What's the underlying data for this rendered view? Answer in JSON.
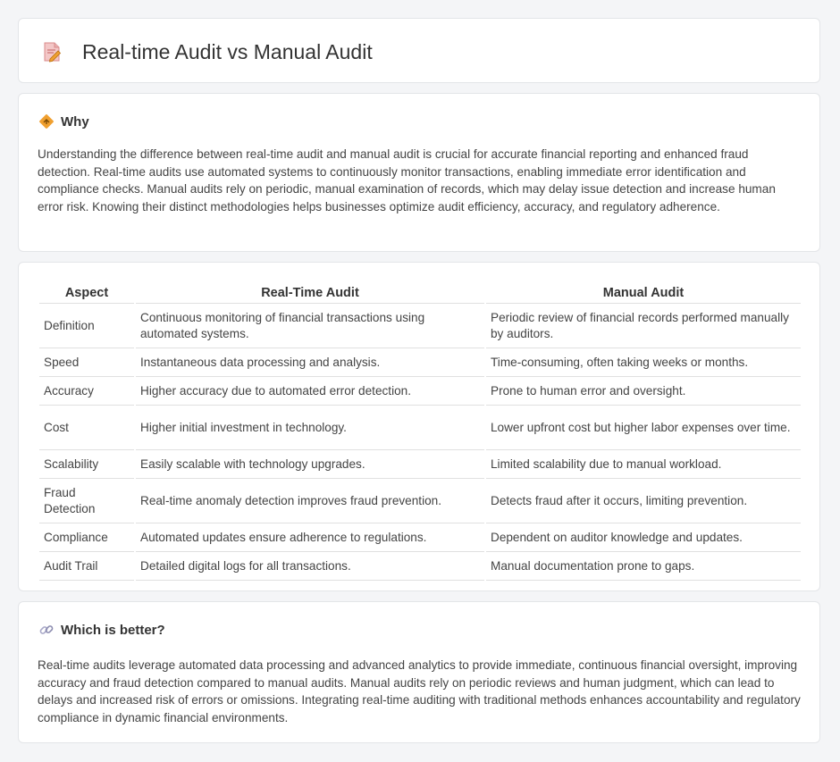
{
  "header": {
    "title": "Real-time Audit vs Manual Audit",
    "icon": "document-edit-icon"
  },
  "why": {
    "icon": "diamond-sign-icon",
    "title": "Why",
    "body": "Understanding the difference between real-time audit and manual audit is crucial for accurate financial reporting and enhanced fraud detection. Real-time audits use automated systems to continuously monitor transactions, enabling immediate error identification and compliance checks. Manual audits rely on periodic, manual examination of records, which may delay issue detection and increase human error risk. Knowing their distinct methodologies helps businesses optimize audit efficiency, accuracy, and regulatory adherence."
  },
  "table": {
    "headers": [
      "Aspect",
      "Real-Time Audit",
      "Manual Audit"
    ],
    "rows": [
      [
        "Definition",
        "Continuous monitoring of financial transactions using automated systems.",
        "Periodic review of financial records performed manually by auditors."
      ],
      [
        "Speed",
        "Instantaneous data processing and analysis.",
        "Time-consuming, often taking weeks or months."
      ],
      [
        "Accuracy",
        "Higher accuracy due to automated error detection.",
        "Prone to human error and oversight."
      ],
      [
        "Cost",
        "Higher initial investment in technology.",
        "Lower upfront cost but higher labor expenses over time."
      ],
      [
        "Scalability",
        "Easily scalable with technology upgrades.",
        "Limited scalability due to manual workload."
      ],
      [
        "Fraud Detection",
        "Real-time anomaly detection improves fraud prevention.",
        "Detects fraud after it occurs, limiting prevention."
      ],
      [
        "Compliance",
        "Automated updates ensure adherence to regulations.",
        "Dependent on auditor knowledge and updates."
      ],
      [
        "Audit Trail",
        "Detailed digital logs for all transactions.",
        "Manual documentation prone to gaps."
      ]
    ]
  },
  "better": {
    "icon": "link-icon",
    "title": "Which is better?",
    "body": "Real-time audits leverage automated data processing and advanced analytics to provide immediate, continuous financial oversight, improving accuracy and fraud detection compared to manual audits. Manual audits rely on periodic reviews and human judgment, which can lead to delays and increased risk of errors or omissions. Integrating real-time auditing with traditional methods enhances accountability and regulatory compliance in dynamic financial environments."
  },
  "colors": {
    "accent_orange": "#f0a030",
    "icon_pink": "#e87a7a",
    "card_border": "#e3e5e8",
    "page_bg": "#f4f5f7"
  }
}
